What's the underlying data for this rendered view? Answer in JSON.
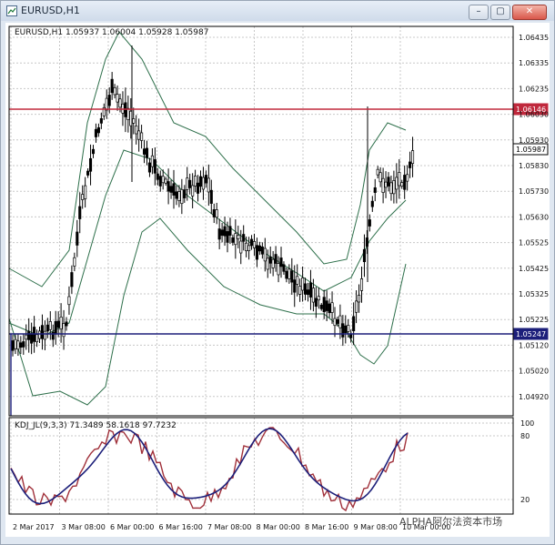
{
  "window": {
    "title": "EURUSD,H1",
    "min_label": "–",
    "max_label": "▢",
    "close_label": "✕"
  },
  "price_panel": {
    "info": "EURUSD,H1  1.05937 1.06004 1.05928 1.05987",
    "price_ticks": [
      "1.06435",
      "1.06335",
      "1.06235",
      "1.06030",
      "1.05930",
      "1.05830",
      "1.05730",
      "1.05630",
      "1.05525",
      "1.05425",
      "1.05325",
      "1.05225",
      "1.05120",
      "1.05020",
      "1.04920"
    ],
    "levels": [
      {
        "label": "1.06146",
        "color": "#c0283c"
      },
      {
        "label": "1.05987",
        "color": "#222222"
      },
      {
        "label": "1.05247",
        "color": "#1c1f7a"
      }
    ]
  },
  "kdj_panel": {
    "info": "KDJ_JL(9,3,3) 71.3489 58.1618 97.7232",
    "ticks": [
      "100",
      "80",
      "20"
    ]
  },
  "time_axis": [
    "2 Mar 2017",
    "3 Mar 08:00",
    "6 Mar 00:00",
    "6 Mar 16:00",
    "7 Mar 08:00",
    "8 Mar 00:00",
    "8 Mar 16:00",
    "9 Mar 08:00",
    "10 Mar 00:00"
  ],
  "watermark": "ALPHA阿尔法资本市场",
  "colors": {
    "bollinger": "#2d6f4a",
    "resistance": "#c0283c",
    "support": "#1c1f7a",
    "k_line": "#1c1f7a",
    "d_line": "#a0303a"
  }
}
